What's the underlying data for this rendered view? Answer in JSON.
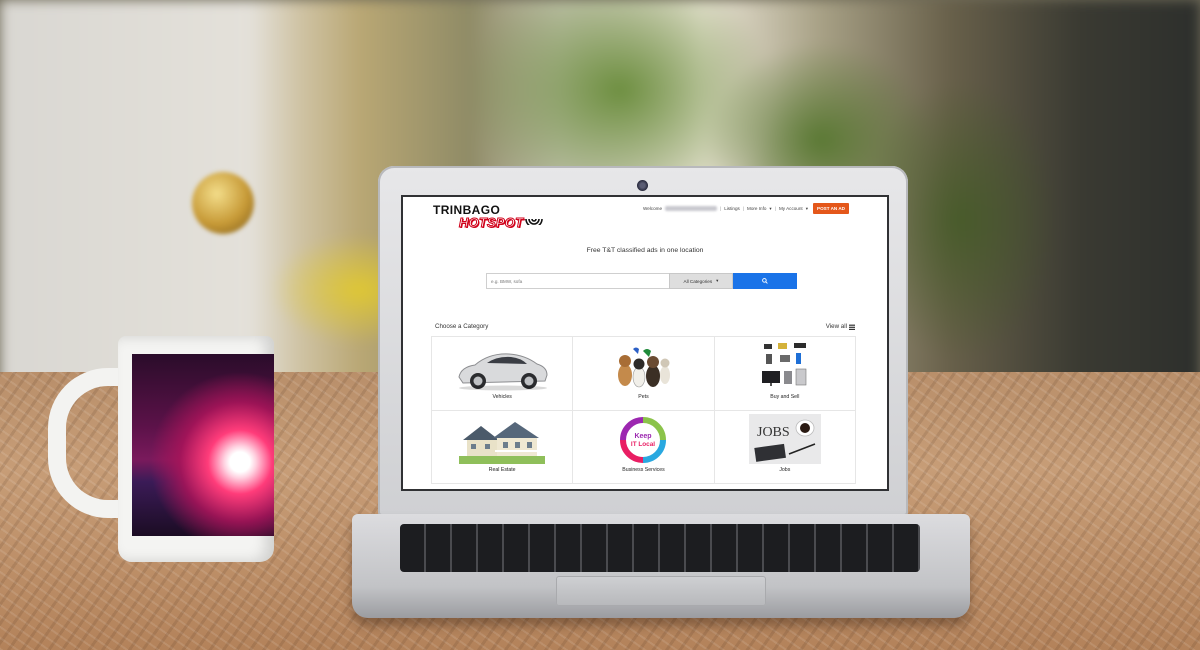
{
  "site": {
    "logo": {
      "line1": "TRINBAGO",
      "line2": "HOTSPOT"
    },
    "nav": {
      "welcome": "Welcome",
      "listings": "Listings",
      "more_info": "More Info",
      "my_account": "My Account",
      "post_ad": "POST AN AD"
    },
    "tagline": "Free T&T classified ads in one location",
    "search": {
      "placeholder": "e.g. BMW, sofa",
      "category_selected": "All Categories"
    },
    "categories_header": {
      "title": "Choose a Category",
      "view_all": "View all"
    },
    "categories": [
      {
        "label": "Vehicles",
        "icon": "car-image"
      },
      {
        "label": "Pets",
        "icon": "pets-image"
      },
      {
        "label": "Buy and Sell",
        "icon": "electronics-image"
      },
      {
        "label": "Real Estate",
        "icon": "house-image"
      },
      {
        "label": "Business Services",
        "icon": "keep-it-local-image"
      },
      {
        "label": "Jobs",
        "icon": "jobs-image"
      }
    ]
  },
  "colors": {
    "post_ad_button": "#e4571a",
    "search_button": "#1a73e8",
    "logo_accent": "#d0021b"
  }
}
